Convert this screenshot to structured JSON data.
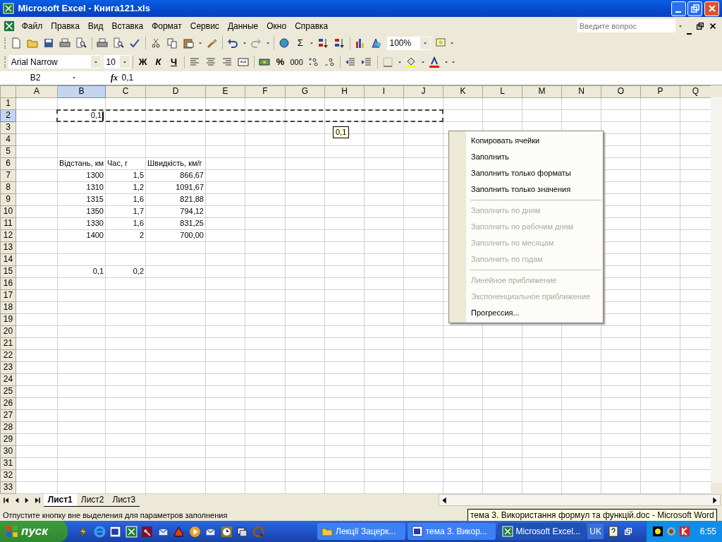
{
  "window": {
    "title": "Microsoft Excel - Книга121.xls"
  },
  "menu_bar": {
    "items": [
      "Файл",
      "Правка",
      "Вид",
      "Вставка",
      "Формат",
      "Сервис",
      "Данные",
      "Окно",
      "Справка"
    ],
    "help_field": {
      "placeholder": "Введите вопрос"
    }
  },
  "standard_toolbar": {
    "autosum": "Σ",
    "zoom": "100%"
  },
  "formatting_toolbar": {
    "font": "Arial Narrow",
    "size": "10",
    "bold": "Ж",
    "italic": "К",
    "underline": "Ч",
    "percent": "%",
    "thousands": "000"
  },
  "formula_bar": {
    "name_box": "B2",
    "fx": "fx",
    "value": "0,1"
  },
  "sheet": {
    "columns": [
      {
        "label": "A",
        "selected": false
      },
      {
        "label": "B",
        "selected": true
      },
      {
        "label": "C",
        "selected": false
      },
      {
        "label": "D",
        "selected": false
      },
      {
        "label": "E",
        "selected": false
      },
      {
        "label": "F",
        "selected": false
      },
      {
        "label": "G",
        "selected": false
      },
      {
        "label": "H",
        "selected": false
      },
      {
        "label": "I",
        "selected": false
      },
      {
        "label": "J",
        "selected": false
      },
      {
        "label": "K",
        "selected": false
      },
      {
        "label": "L",
        "selected": false
      },
      {
        "label": "M",
        "selected": false
      },
      {
        "label": "N",
        "selected": false
      },
      {
        "label": "O",
        "selected": false
      },
      {
        "label": "P",
        "selected": false
      },
      {
        "label": "Q",
        "selected": false
      }
    ],
    "rows": [
      {
        "label": "1",
        "selected": false
      },
      {
        "label": "2",
        "selected": true,
        "kind": "values",
        "cells": [
          "0,1"
        ]
      },
      {
        "label": "3",
        "selected": false
      },
      {
        "label": "4",
        "selected": false
      },
      {
        "label": "5",
        "selected": false
      },
      {
        "label": "6",
        "selected": false,
        "kind": "header",
        "cells": [
          "Відстань, км",
          "Час, г",
          "Швидкість, км/г"
        ]
      },
      {
        "label": "7",
        "selected": false,
        "kind": "values",
        "cells": [
          "1300",
          "1,5",
          "866,67"
        ]
      },
      {
        "label": "8",
        "selected": false,
        "kind": "values",
        "cells": [
          "1310",
          "1,2",
          "1091,67"
        ]
      },
      {
        "label": "9",
        "selected": false,
        "kind": "values",
        "cells": [
          "1315",
          "1,6",
          "821,88"
        ]
      },
      {
        "label": "10",
        "selected": false,
        "kind": "values",
        "cells": [
          "1350",
          "1,7",
          "794,12"
        ]
      },
      {
        "label": "11",
        "selected": false,
        "kind": "values",
        "cells": [
          "1330",
          "1,6",
          "831,25"
        ]
      },
      {
        "label": "12",
        "selected": false,
        "kind": "values",
        "cells": [
          "1400",
          "2",
          "700,00"
        ]
      },
      {
        "label": "13",
        "selected": false
      },
      {
        "label": "14",
        "selected": false
      },
      {
        "label": "15",
        "selected": false,
        "kind": "values",
        "cells": [
          "0,1",
          "0,2"
        ]
      },
      {
        "label": "16",
        "selected": false
      },
      {
        "label": "17",
        "selected": false
      },
      {
        "label": "18",
        "selected": false
      },
      {
        "label": "19",
        "selected": false
      },
      {
        "label": "20",
        "selected": false
      },
      {
        "label": "21",
        "selected": false
      },
      {
        "label": "22",
        "selected": false
      },
      {
        "label": "23",
        "selected": false
      },
      {
        "label": "24",
        "selected": false
      },
      {
        "label": "25",
        "selected": false
      },
      {
        "label": "26",
        "selected": false
      },
      {
        "label": "27",
        "selected": false
      },
      {
        "label": "28",
        "selected": false
      },
      {
        "label": "29",
        "selected": false
      },
      {
        "label": "30",
        "selected": false
      },
      {
        "label": "31",
        "selected": false
      },
      {
        "label": "32",
        "selected": false
      },
      {
        "label": "33",
        "selected": false
      }
    ],
    "fill_tooltip": "0,1"
  },
  "context_menu": {
    "groups": [
      [
        {
          "label": "Копировать ячейки",
          "disabled": false
        },
        {
          "label": "Заполнить",
          "disabled": false
        },
        {
          "label": "Заполнить только форматы",
          "disabled": false
        },
        {
          "label": "Заполнить только значения",
          "disabled": false
        }
      ],
      [
        {
          "label": "Заполнить по дням",
          "disabled": true
        },
        {
          "label": "Заполнить по рабочим дням",
          "disabled": true
        },
        {
          "label": "Заполнить по месяцам",
          "disabled": true
        },
        {
          "label": "Заполнить по годам",
          "disabled": true
        }
      ],
      [
        {
          "label": "Линейное приближение",
          "disabled": true
        },
        {
          "label": "Экспоненциальное приближение",
          "disabled": true
        },
        {
          "label": "Прогрессия...",
          "disabled": false
        }
      ]
    ]
  },
  "sheet_tabs": [
    {
      "label": "Лист1",
      "selected": true
    },
    {
      "label": "Лист2",
      "selected": false
    },
    {
      "label": "Лист3",
      "selected": false
    }
  ],
  "status_bar": {
    "text": "Отпустите кнопку вне выделения для параметров заполнения",
    "tooltip": "тема 3. Використання формул та функцій.doc - Microsoft Word"
  },
  "taskbar": {
    "start": "пуск",
    "tasks": [
      {
        "label": "Лекції Зацерк...",
        "kind": "folder",
        "selected": false
      },
      {
        "label": "тема 3. Викор...",
        "kind": "word",
        "selected": false
      },
      {
        "label": "Microsoft Excel...",
        "kind": "excel",
        "selected": true
      }
    ],
    "language": "UK",
    "clock": "6:55"
  }
}
